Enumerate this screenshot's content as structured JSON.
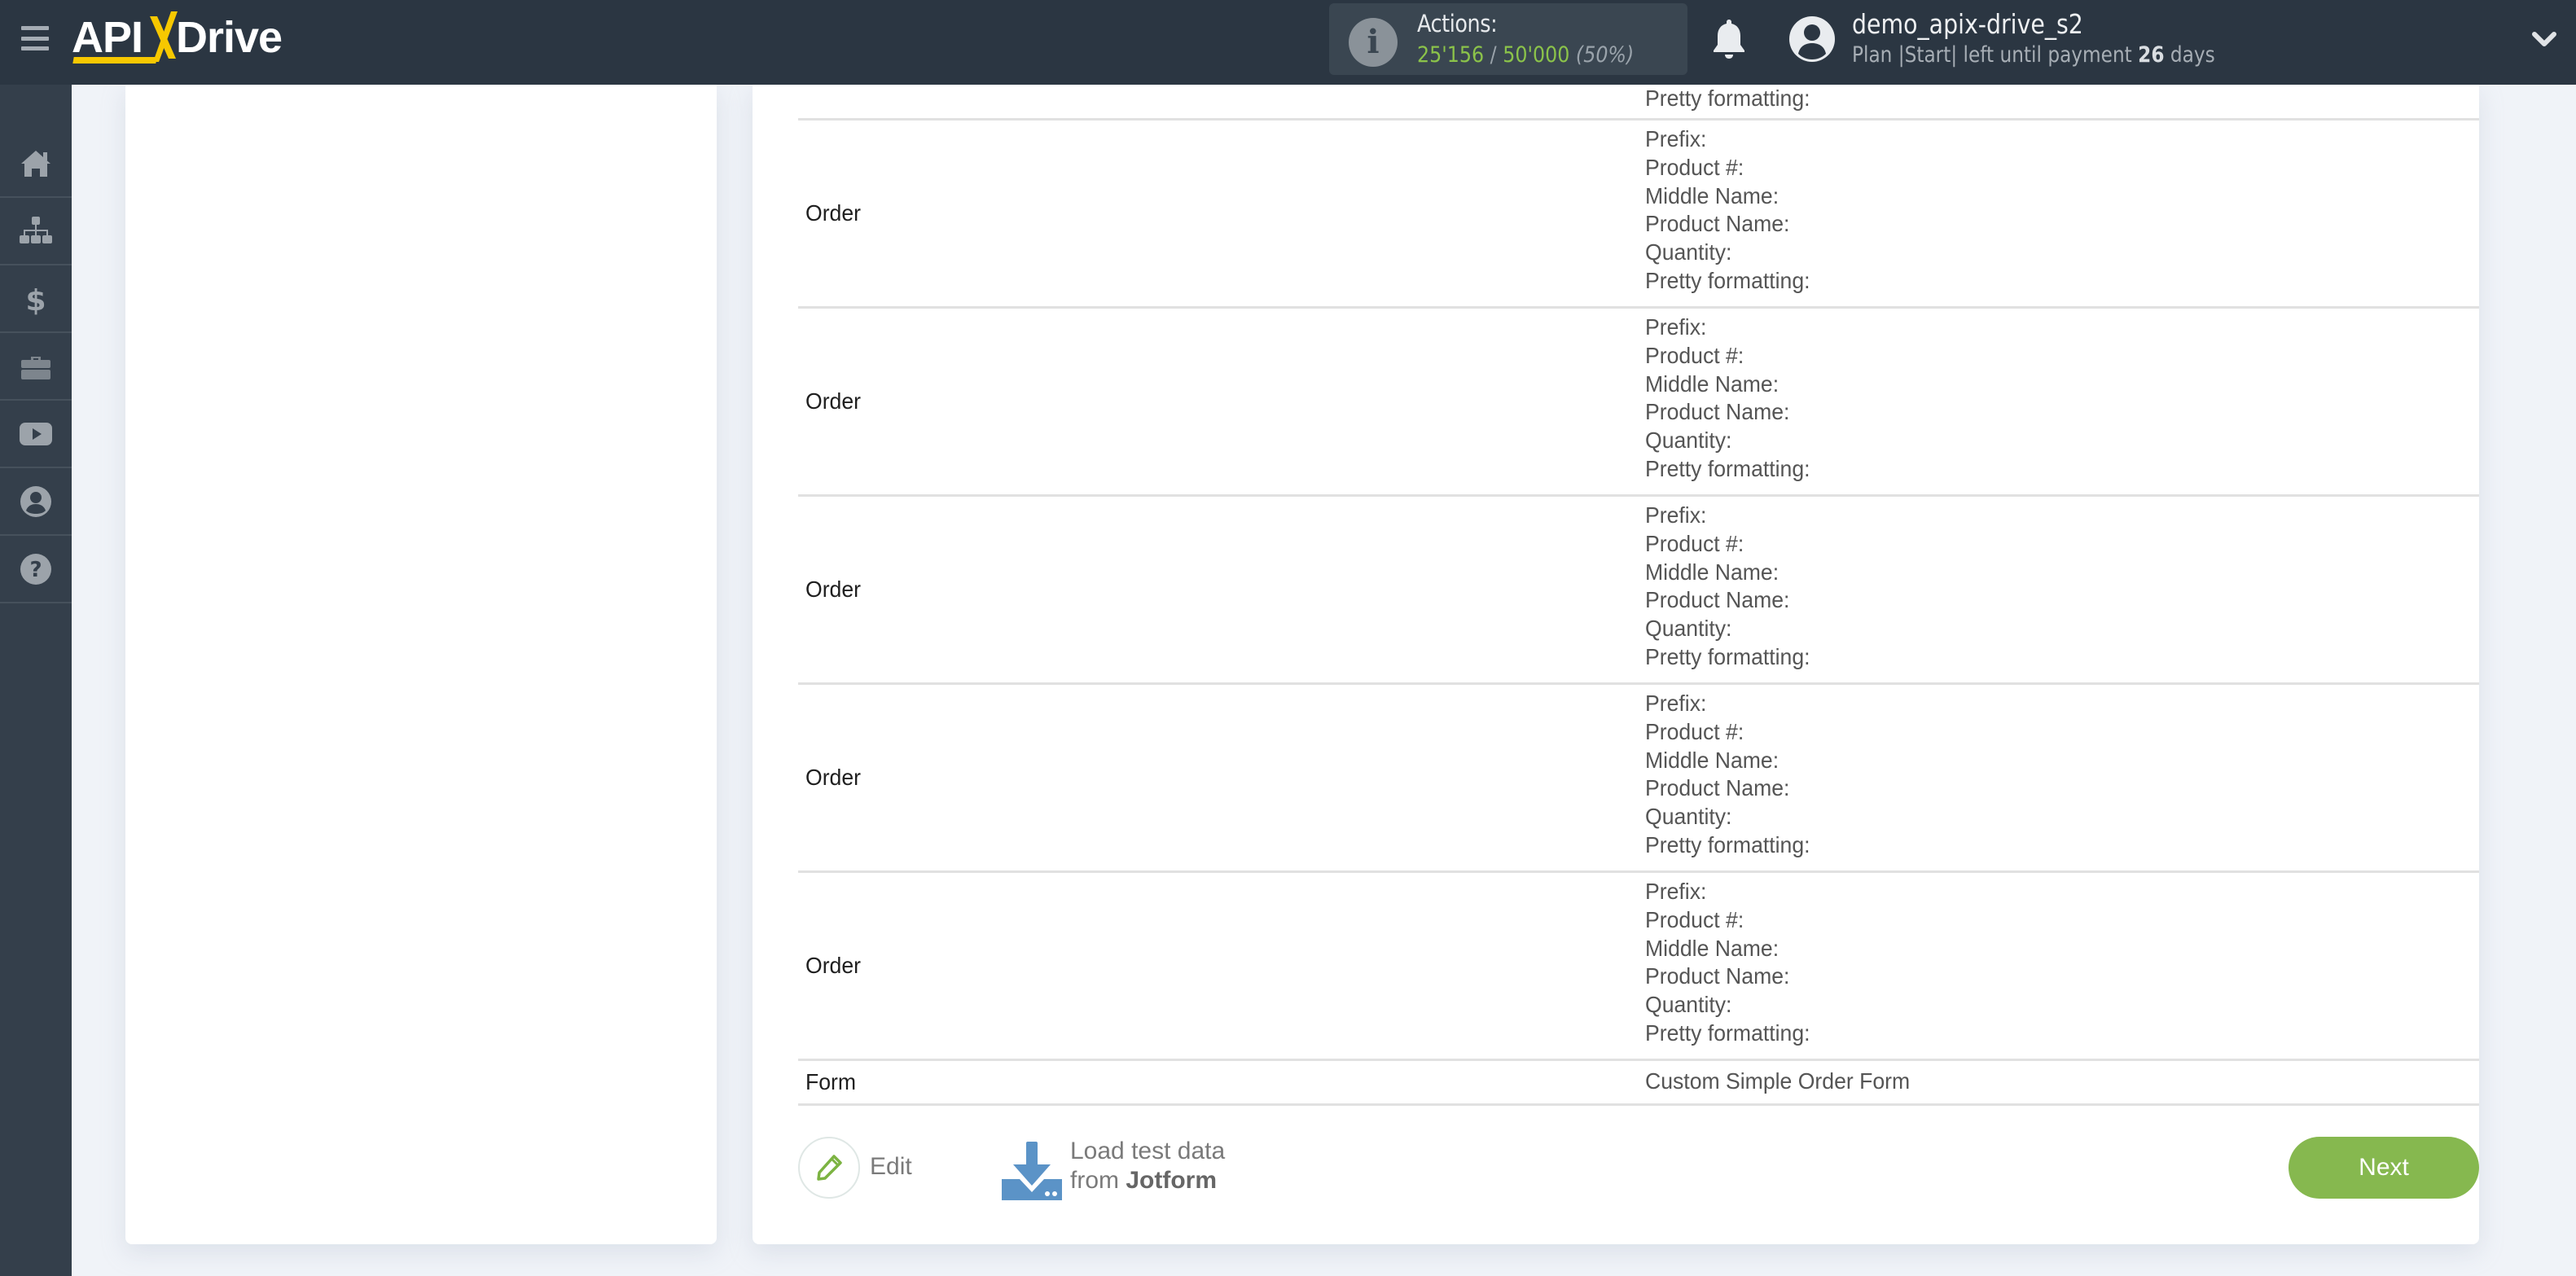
{
  "header": {
    "brand_left": "API",
    "brand_right": "Drive",
    "actions": {
      "label": "Actions:",
      "used": "25'156",
      "separator": " / ",
      "total": "50'000",
      "percent": "(50%)"
    },
    "user": {
      "name": "demo_apix-drive_s2",
      "plan_prefix": "Plan |Start| left until payment ",
      "days": "26",
      "days_suffix": " days"
    }
  },
  "sidebar": {
    "items": [
      {
        "name": "home",
        "icon": "home-icon"
      },
      {
        "name": "connections",
        "icon": "sitemap-icon"
      },
      {
        "name": "billing",
        "icon": "dollar-icon"
      },
      {
        "name": "tools",
        "icon": "briefcase-icon"
      },
      {
        "name": "videos",
        "icon": "youtube-icon"
      },
      {
        "name": "account",
        "icon": "user-circle-icon"
      },
      {
        "name": "help",
        "icon": "question-circle-icon"
      }
    ]
  },
  "table": {
    "top_tail_value": "Pretty formatting:",
    "rows": [
      {
        "label": "Order",
        "values": [
          "Prefix:",
          "Product #:",
          "Middle Name:",
          "Product Name:",
          "Quantity:",
          "Pretty formatting:"
        ]
      },
      {
        "label": "Order",
        "values": [
          "Prefix:",
          "Product #:",
          "Middle Name:",
          "Product Name:",
          "Quantity:",
          "Pretty formatting:"
        ]
      },
      {
        "label": "Order",
        "values": [
          "Prefix:",
          "Product #:",
          "Middle Name:",
          "Product Name:",
          "Quantity:",
          "Pretty formatting:"
        ]
      },
      {
        "label": "Order",
        "values": [
          "Prefix:",
          "Product #:",
          "Middle Name:",
          "Product Name:",
          "Quantity:",
          "Pretty formatting:"
        ]
      },
      {
        "label": "Order",
        "values": [
          "Prefix:",
          "Product #:",
          "Middle Name:",
          "Product Name:",
          "Quantity:",
          "Pretty formatting:"
        ]
      }
    ],
    "form_row": {
      "label": "Form",
      "value": "Custom Simple Order Form"
    }
  },
  "footer": {
    "edit_label": "Edit",
    "load_line1": "Load test data",
    "load_from": "from ",
    "load_source": "Jotform",
    "next_label": "Next"
  },
  "colors": {
    "header_bg": "#2b3642",
    "sidebar_bg": "#343f4b",
    "accent_green": "#86b84f",
    "count_green": "#8bc34a",
    "logo_yellow": "#f7c800",
    "download_blue": "#5b93c7"
  }
}
